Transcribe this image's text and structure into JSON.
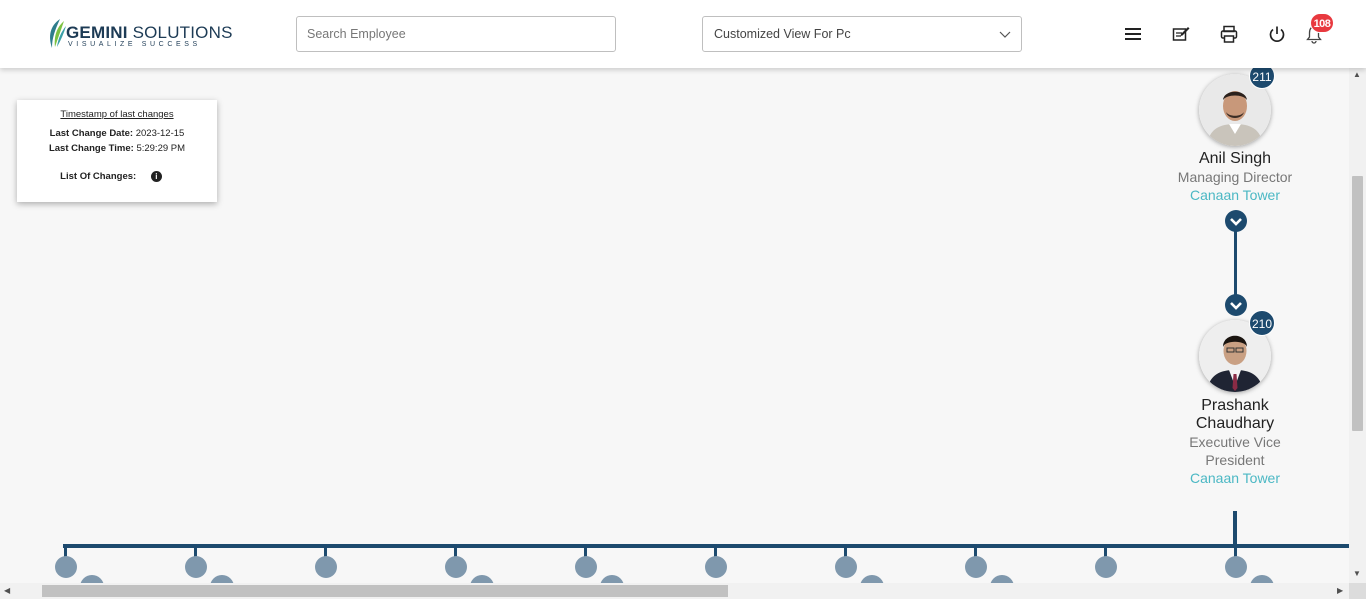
{
  "header": {
    "logo": {
      "name_bold": "GEMINI",
      "name_rest": " SOLUTIONS",
      "tagline": "VISUALIZE SUCCESS"
    },
    "search": {
      "placeholder": "Search Employee",
      "value": ""
    },
    "view_select": {
      "value": "Customized View For Pc"
    },
    "icons": [
      "menu-icon",
      "edit-notes-icon",
      "print-icon",
      "power-icon",
      "bell-icon"
    ],
    "notification_count": "108"
  },
  "timestamp_card": {
    "title": "Timestamp of last changes",
    "date_label": "Last Change Date:",
    "date_value": "2023-12-15",
    "time_label": "Last Change Time:",
    "time_value": "5:29:29 PM",
    "changes_label": "List Of Changes:"
  },
  "nodes": [
    {
      "count": "211",
      "name": "Anil Singh",
      "title": "Managing Director",
      "location": "Canaan Tower"
    },
    {
      "count": "210",
      "name": "Prashank Chaudhary",
      "title": "Executive Vice President",
      "location": "Canaan Tower"
    }
  ],
  "colors": {
    "accent": "#1d4a6e",
    "location": "#4bb8c4",
    "badge": "#e8393f"
  }
}
